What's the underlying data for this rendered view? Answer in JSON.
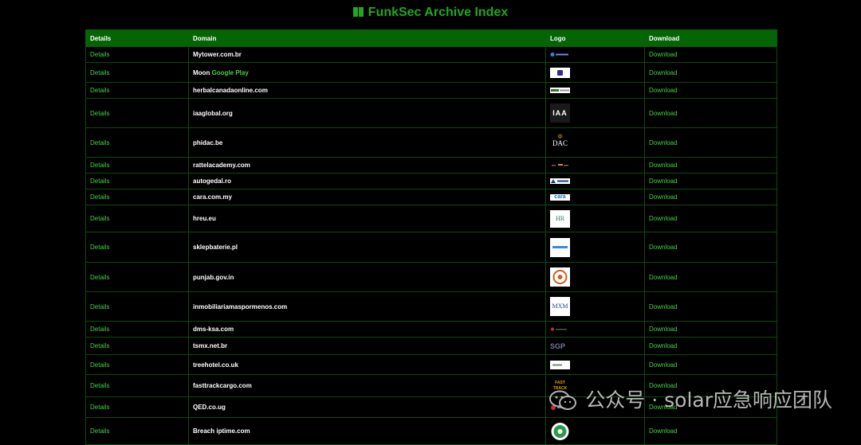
{
  "page": {
    "title": "FunkSec Archive Index"
  },
  "table": {
    "headers": [
      "Details",
      "Domain",
      "Logo",
      "Download"
    ],
    "rows": [
      {
        "details": "Details",
        "domain": "Mytower.com.br",
        "download": "Download"
      },
      {
        "details": "Details",
        "domain": "Moon",
        "domain_extra": "Google Play",
        "download": "Download"
      },
      {
        "details": "Details",
        "domain": "herbalcanadaonline.com",
        "download": "Download"
      },
      {
        "details": "Details",
        "domain": "iaaglobal.org",
        "logo_text": "IAA",
        "download": "Download"
      },
      {
        "details": "Details",
        "domain": "phidac.be",
        "logo_text": "DAC",
        "download": "Download"
      },
      {
        "details": "Details",
        "domain": "rattelacademy.com",
        "download": "Download"
      },
      {
        "details": "Details",
        "domain": "autogedal.ro",
        "download": "Download"
      },
      {
        "details": "Details",
        "domain": "cara.com.my",
        "logo_text": "cara",
        "download": "Download"
      },
      {
        "details": "Details",
        "domain": "hreu.eu",
        "logo_text": "HR",
        "download": "Download"
      },
      {
        "details": "Details",
        "domain": "sklepbaterie.pl",
        "download": "Download"
      },
      {
        "details": "Details",
        "domain": "punjab.gov.in",
        "download": "Download"
      },
      {
        "details": "Details",
        "domain": "inmobiliariamaspormenos.com",
        "logo_text": "MXM",
        "download": "Download"
      },
      {
        "details": "Details",
        "domain": "dms-ksa.com",
        "download": "Download"
      },
      {
        "details": "Details",
        "domain": "tsmx.net.br",
        "logo_text": "SGP",
        "download": "Download"
      },
      {
        "details": "Details",
        "domain": "treehotel.co.uk",
        "download": "Download"
      },
      {
        "details": "Details",
        "domain": "fasttrackcargo.com",
        "logo_text": "FAST TRACK",
        "download": "Download"
      },
      {
        "details": "Details",
        "domain": "QED.co.ug",
        "download": "Download"
      },
      {
        "details": "Details",
        "domain": "Breach iptime.com",
        "download": "Download"
      }
    ]
  },
  "watermark": {
    "text": "公众号 · solar应急响应团队"
  }
}
